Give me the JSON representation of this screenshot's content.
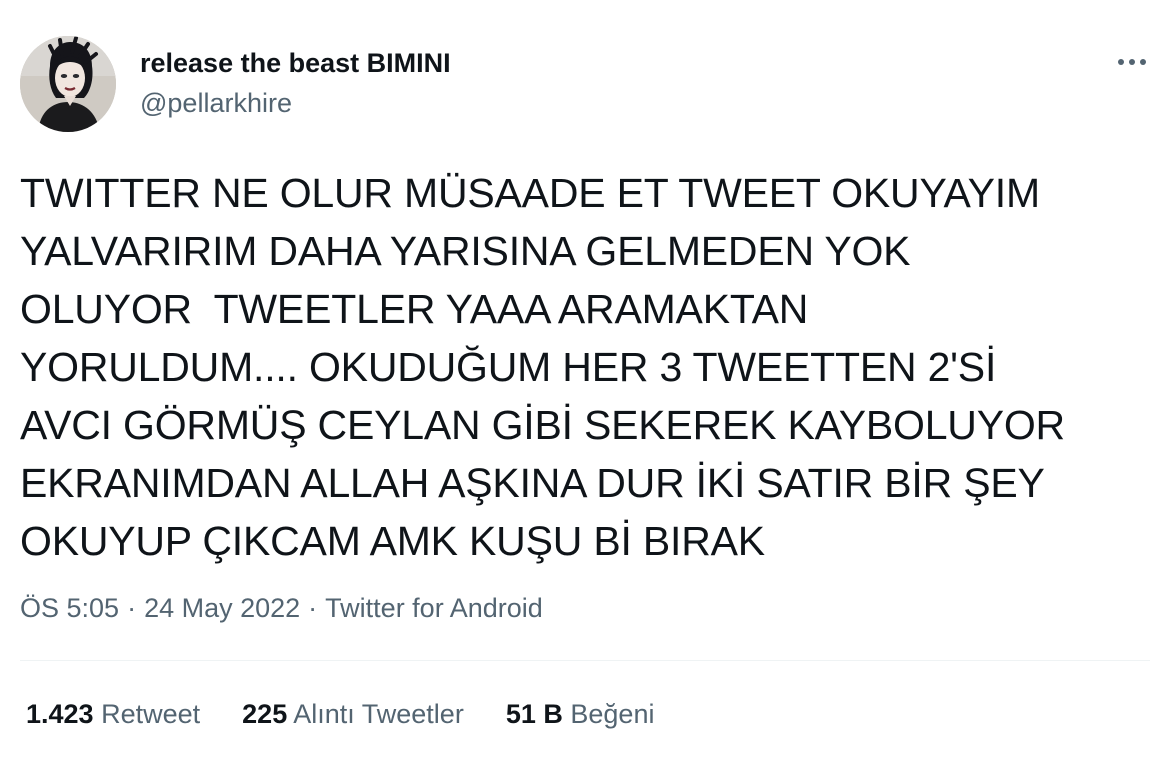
{
  "author": {
    "display_name": "release the beast BIMINI",
    "handle": "@pellarkhire"
  },
  "tweet": {
    "text": "TWITTER NE OLUR MÜSAADE ET TWEET OKUYAYIM\nYALVARIRIM DAHA YARISINA GELMEDEN YOK\nOLUYOR  TWEETLER YAAA ARAMAKTAN\nYORULDUM.... OKUDUĞUM HER 3 TWEETTEN 2'Sİ\nAVCI GÖRMÜŞ CEYLAN GİBİ SEKEREK KAYBOLUYOR\nEKRANIMDAN ALLAH AŞKINA DUR İKİ SATIR BİR ŞEY\nOKUYUP ÇIKCAM AMK KUŞU Bİ BIRAK"
  },
  "meta": {
    "time": "ÖS 5:05",
    "separator": "·",
    "date": "24 May 2022",
    "source": "Twitter for Android"
  },
  "stats": {
    "retweets": {
      "count": "1.423",
      "label": "Retweet"
    },
    "quotes": {
      "count": "225",
      "label": "Alıntı Tweetler"
    },
    "likes": {
      "count": "51 B",
      "label": "Beğeni"
    }
  },
  "icons": {
    "more": "more-horizontal-icon",
    "avatar": "profile-avatar"
  },
  "colors": {
    "primary_text": "#0f1419",
    "secondary_text": "#536471",
    "divider": "#eff3f4"
  }
}
